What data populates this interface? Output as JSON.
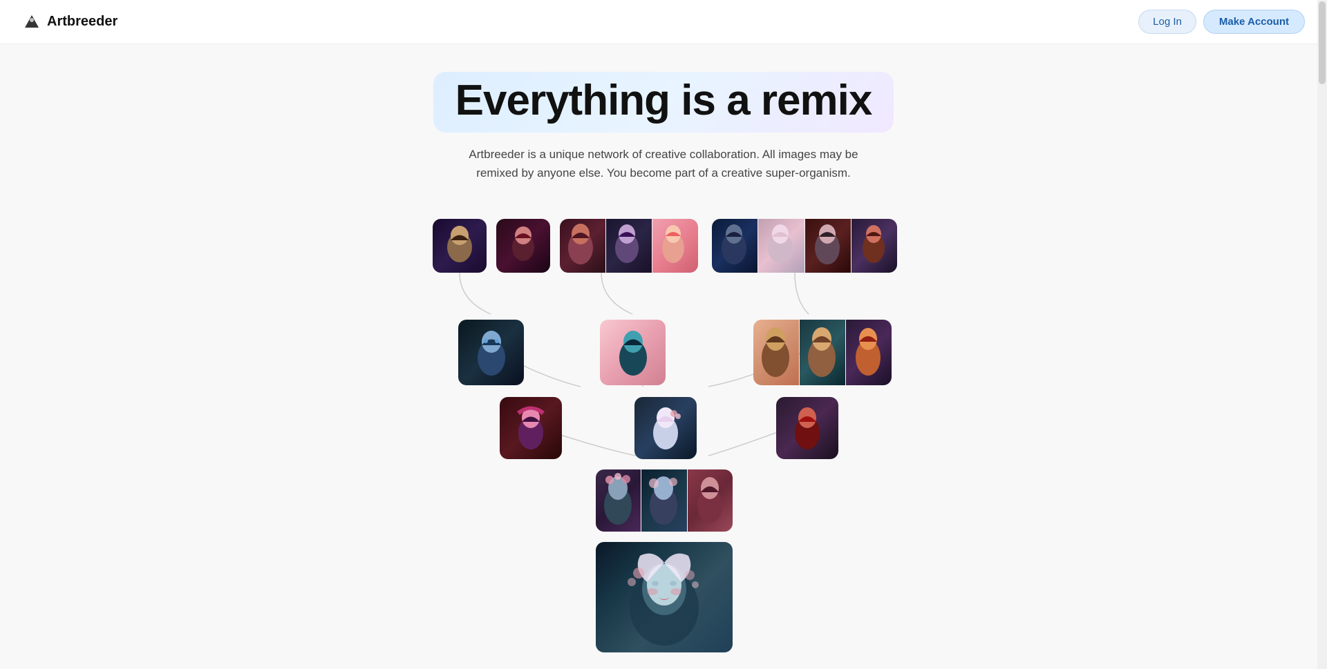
{
  "header": {
    "logo_text": "Artbreeder",
    "login_label": "Log In",
    "make_account_label": "Make Account"
  },
  "hero": {
    "title": "Everything is a remix",
    "subtitle": "Artbreeder is a unique network of creative collaboration. All images may be remixed by anyone else. You become part of a creative super-organism."
  },
  "tree": {
    "description": "Visual family tree of AI-generated portraits",
    "rows": [
      {
        "level": 0,
        "images": [
          "single-portrait-dark",
          "single-portrait-red",
          "strip-3-warm",
          "strip-4-fantasy"
        ]
      },
      {
        "level": 1,
        "images": [
          "single-blue-fantasy",
          "single-teal-portrait",
          "strip-3-auburn"
        ]
      },
      {
        "level": 2,
        "images": [
          "single-pink-hat",
          "single-white-floral",
          "single-fire-red"
        ]
      },
      {
        "level": 3,
        "images": [
          "strip-3-garden"
        ]
      },
      {
        "level": 4,
        "images": [
          "large-final"
        ]
      }
    ]
  }
}
